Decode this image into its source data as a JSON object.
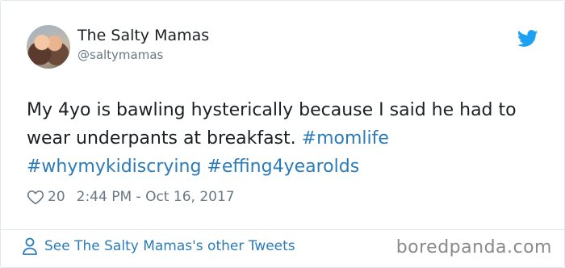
{
  "tweet": {
    "author_name": "The Salty Mamas",
    "author_handle": "@saltymamas",
    "text_plain": "My 4yo is bawling hysterically because I said he had to wear underpants at breakfast.",
    "hashtags": [
      "#momlife",
      "#whymykidiscrying",
      "#effing4yearolds"
    ],
    "like_count": "20",
    "timestamp": "2:44 PM - Oct 16, 2017"
  },
  "footer": {
    "other_tweets_link": "See The Salty Mamas's other Tweets"
  },
  "watermark": "boredpanda.com",
  "colors": {
    "link": "#2b7bb9",
    "text": "#1c2022",
    "secondary": "#697882",
    "twitter_blue": "#1da1f2",
    "border": "#e1e8ed"
  },
  "icons": {
    "brand": "twitter-bird-icon",
    "like": "heart-icon",
    "profile": "person-icon"
  }
}
